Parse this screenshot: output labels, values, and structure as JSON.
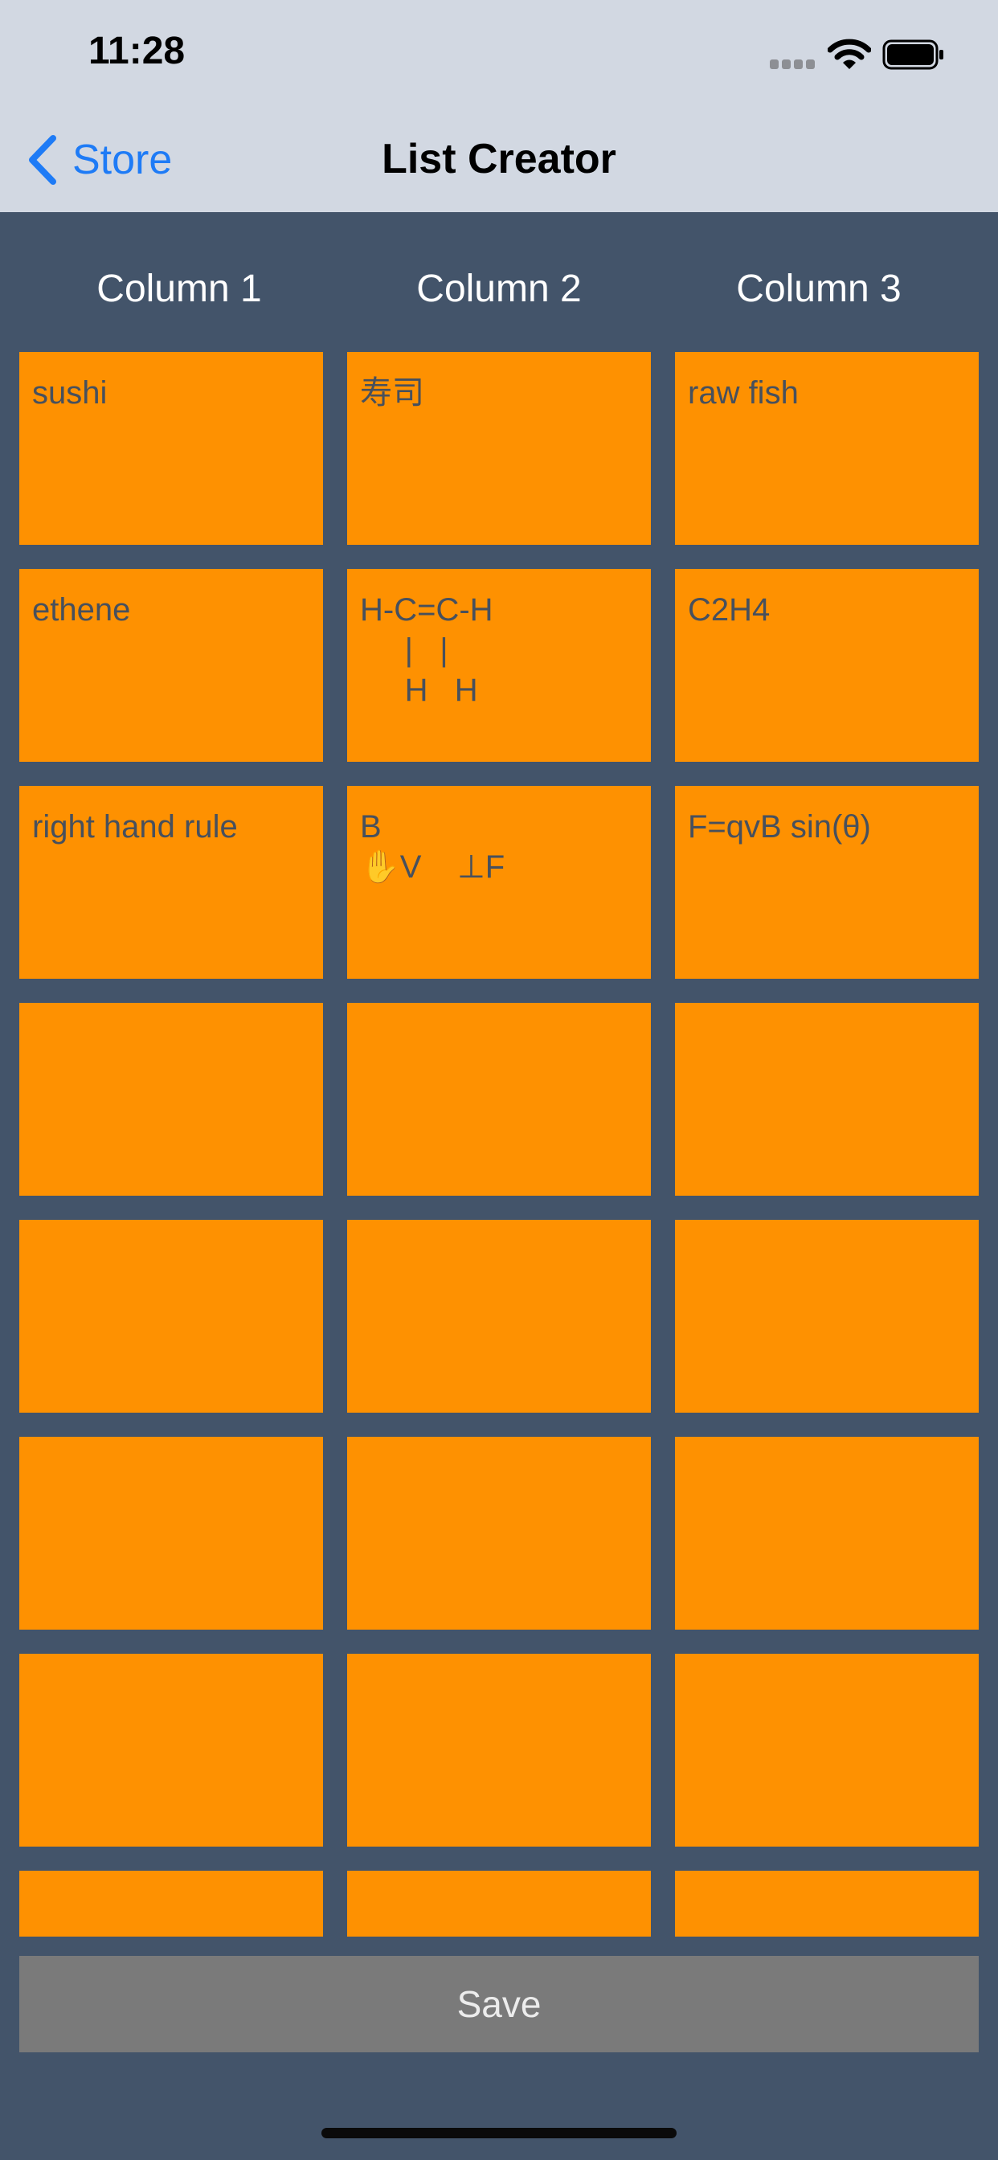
{
  "status_bar": {
    "time": "11:28"
  },
  "nav": {
    "back_label": "Store",
    "title": "List Creator"
  },
  "columns": [
    "Column 1",
    "Column 2",
    "Column 3"
  ],
  "rows": [
    [
      "sushi",
      "寿司",
      "raw fish"
    ],
    [
      "ethene",
      "H-C=C-H\n     |   |\n     H   H",
      "C2H4"
    ],
    [
      "right hand rule",
      "B\n✋V    ⊥F",
      "F=qvB sin(θ)"
    ],
    [
      "",
      "",
      ""
    ],
    [
      "",
      "",
      ""
    ],
    [
      "",
      "",
      ""
    ],
    [
      "",
      "",
      ""
    ],
    [
      "",
      "",
      ""
    ]
  ],
  "save_label": "Save",
  "colors": {
    "background": "#43546a",
    "bar": "#d2d8e2",
    "cell": "#fe9101",
    "cell_text": "#47505d",
    "accent": "#1e7bf6",
    "save_button": "#7a7a7a"
  },
  "icons": {
    "back": "chevron-left-icon",
    "signal": "signal-icon",
    "wifi": "wifi-icon",
    "battery": "battery-icon"
  }
}
